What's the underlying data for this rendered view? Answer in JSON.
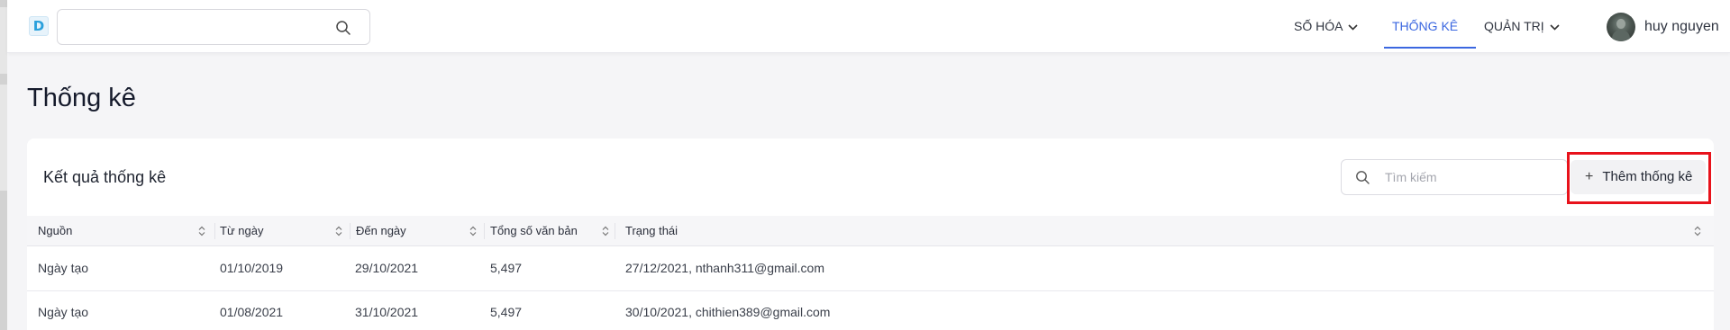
{
  "header": {
    "logo_text": "D",
    "search": {
      "value": "",
      "placeholder": ""
    },
    "nav": [
      {
        "label": "SỐ HÓA",
        "has_dropdown": true,
        "active": false
      },
      {
        "label": "THỐNG KÊ",
        "has_dropdown": false,
        "active": true
      },
      {
        "label": "QUẢN TRỊ",
        "has_dropdown": true,
        "active": false
      }
    ],
    "user_name": "huy nguyen",
    "accent_color": "#3b67e0"
  },
  "page": {
    "title": "Thống kê"
  },
  "card": {
    "title": "Kết quả thống kê",
    "search_placeholder": "Tìm kiếm",
    "add_button_label": "Thêm thống kê",
    "highlight_color": "#e8121b"
  },
  "table": {
    "columns": [
      "Nguồn",
      "Từ ngày",
      "Đến ngày",
      "Tổng số văn bản",
      "Trạng thái"
    ],
    "rows": [
      {
        "source": "Ngày tạo",
        "from": "01/10/2019",
        "to": "29/10/2021",
        "total": "5,497",
        "status": "27/12/2021, nthanh311@gmail.com"
      },
      {
        "source": "Ngày tạo",
        "from": "01/08/2021",
        "to": "31/10/2021",
        "total": "5,497",
        "status": "30/10/2021, chithien389@gmail.com"
      }
    ]
  }
}
